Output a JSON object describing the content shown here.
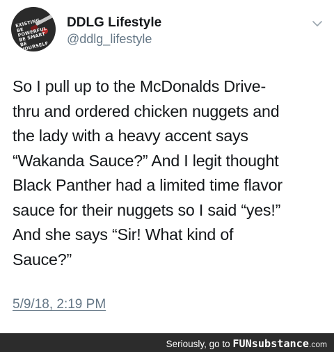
{
  "tweet": {
    "avatar": {
      "icon": "profile-avatar-icon",
      "lines": [
        "EXISTING",
        "BE POWERFUL",
        "BE SMART",
        "BE YOURSELF"
      ]
    },
    "display_name": "DDLG Lifestyle",
    "handle": "@ddlg_lifestyle",
    "menu_icon": "chevron-down-icon",
    "text_lines": [
      "So I pull up to the McDonalds Drive-",
      "thru and ordered chicken nuggets and",
      "the lady with a heavy accent says",
      "“Wakanda Sauce?” And I legit thought",
      "Black Panther had a limited time flavor",
      "sauce for their nuggets so I said “yes!”",
      "And she says “Sir! What kind of",
      "Sauce?”"
    ],
    "timestamp": "5/9/18, 2:19 PM"
  },
  "footer": {
    "prefix": "Seriously, go to",
    "brand": "FUNsubstance",
    "domain": ".com",
    "background": "#2c2c2c"
  },
  "colors": {
    "text": "#14171a",
    "secondary": "#657786"
  }
}
